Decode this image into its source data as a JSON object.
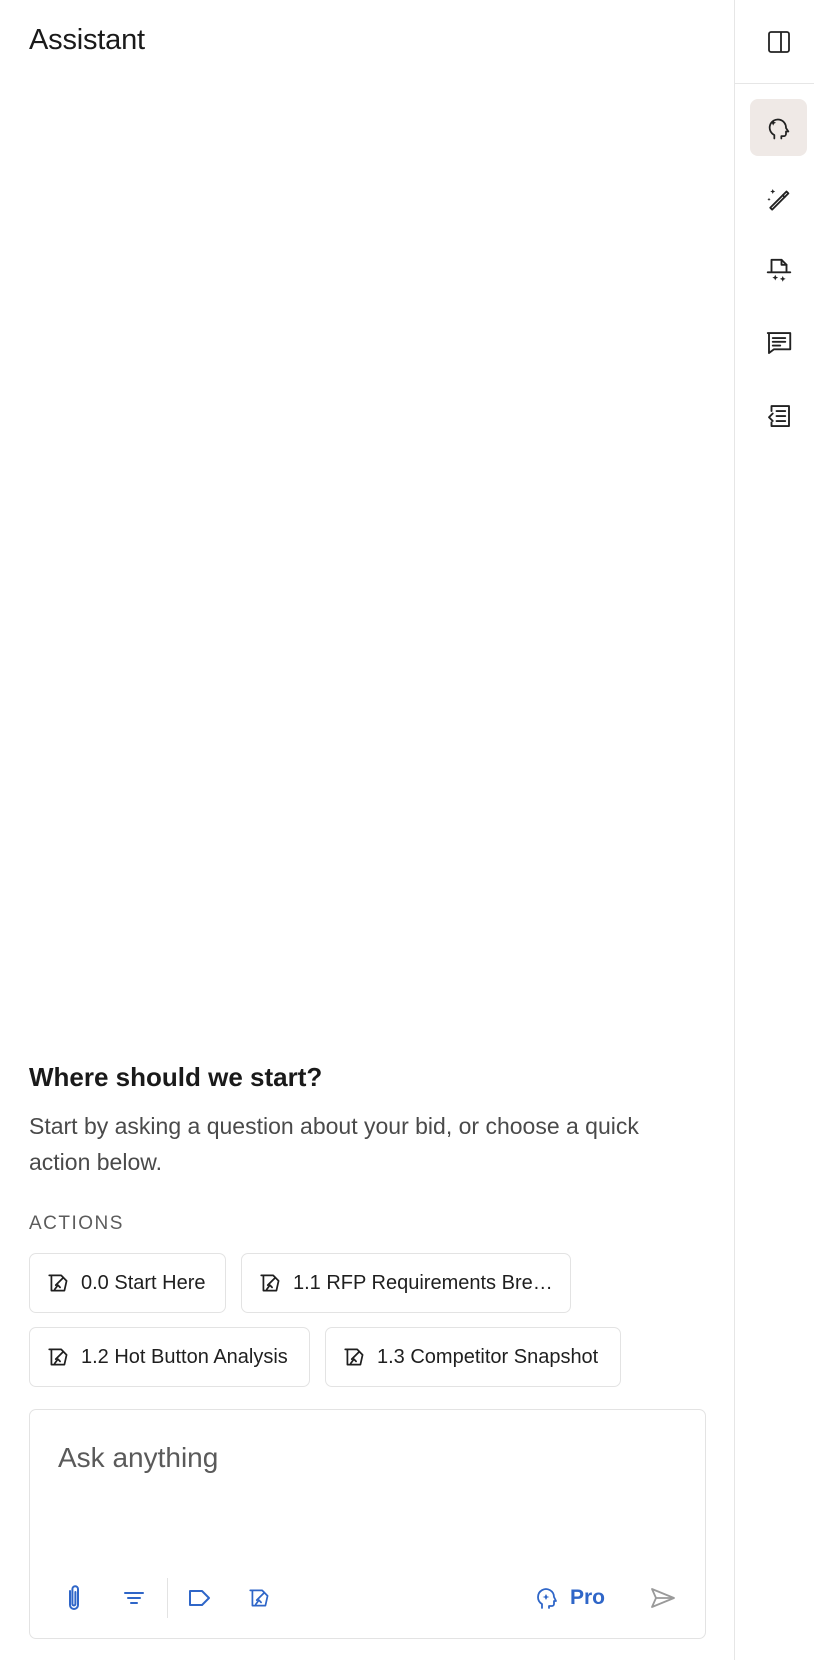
{
  "header": {
    "title": "Assistant"
  },
  "intro": {
    "heading": "Where should we start?",
    "text": "Start by asking a question about your bid, or choose a quick action below."
  },
  "actions": {
    "label": "ACTIONS",
    "items": [
      {
        "label": "0.0 Start Here",
        "icon": "analysis-icon"
      },
      {
        "label": "1.1 RFP Requirements Brea...",
        "icon": "analysis-icon"
      },
      {
        "label": "1.2 Hot Button Analysis",
        "icon": "analysis-icon"
      },
      {
        "label": "1.3 Competitor Snapshot",
        "icon": "analysis-icon"
      }
    ]
  },
  "composer": {
    "placeholder": "Ask anything",
    "value": "",
    "tools": [
      "paperclip-icon",
      "filter-icon",
      "tag-icon",
      "analysis-icon"
    ],
    "pro_label": "Pro",
    "send_icon": "send-icon"
  },
  "rail": {
    "items": [
      {
        "name": "panel-toggle-icon"
      },
      {
        "name": "assistant-sparkle-head-icon",
        "active": true
      },
      {
        "name": "magic-wand-icon"
      },
      {
        "name": "document-sparkle-icon"
      },
      {
        "name": "comment-icon"
      },
      {
        "name": "document-list-icon"
      }
    ]
  },
  "colors": {
    "accent": "#2f66c8",
    "active_rail_bg": "#efe9e6",
    "border": "#e3e3e3",
    "text": "#1a1a1a",
    "muted": "#4a4a4a"
  }
}
